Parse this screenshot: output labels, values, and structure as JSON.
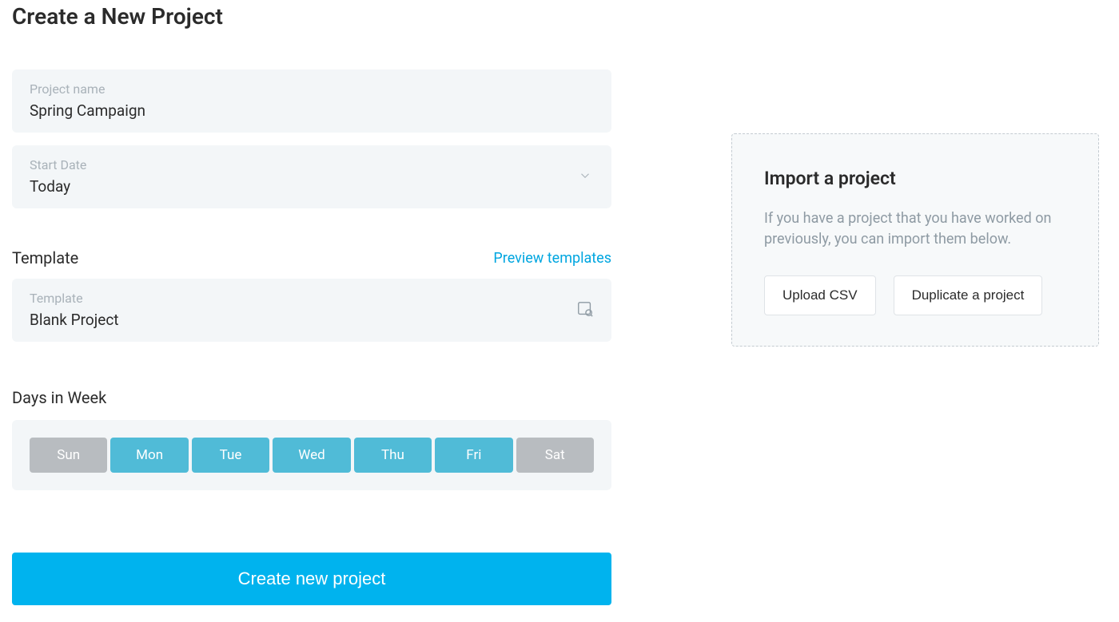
{
  "page": {
    "title": "Create a New Project"
  },
  "form": {
    "project_name": {
      "label": "Project name",
      "value": "Spring Campaign"
    },
    "start_date": {
      "label": "Start Date",
      "value": "Today"
    },
    "template_section": {
      "title": "Template",
      "preview_link": "Preview templates"
    },
    "template": {
      "label": "Template",
      "value": "Blank Project"
    },
    "days_section_title": "Days in Week",
    "days": [
      {
        "label": "Sun",
        "active": false
      },
      {
        "label": "Mon",
        "active": true
      },
      {
        "label": "Tue",
        "active": true
      },
      {
        "label": "Wed",
        "active": true
      },
      {
        "label": "Thu",
        "active": true
      },
      {
        "label": "Fri",
        "active": true
      },
      {
        "label": "Sat",
        "active": false
      }
    ],
    "submit_label": "Create new project"
  },
  "import": {
    "title": "Import a project",
    "description": "If you have a project that you have worked on previously, you can import them below.",
    "upload_label": "Upload CSV",
    "duplicate_label": "Duplicate a project"
  },
  "colors": {
    "primary": "#00b3ee",
    "day_active": "#50bbd7",
    "day_inactive": "#b8bcc0",
    "link": "#00a6e0",
    "field_bg": "#f3f6f8"
  }
}
